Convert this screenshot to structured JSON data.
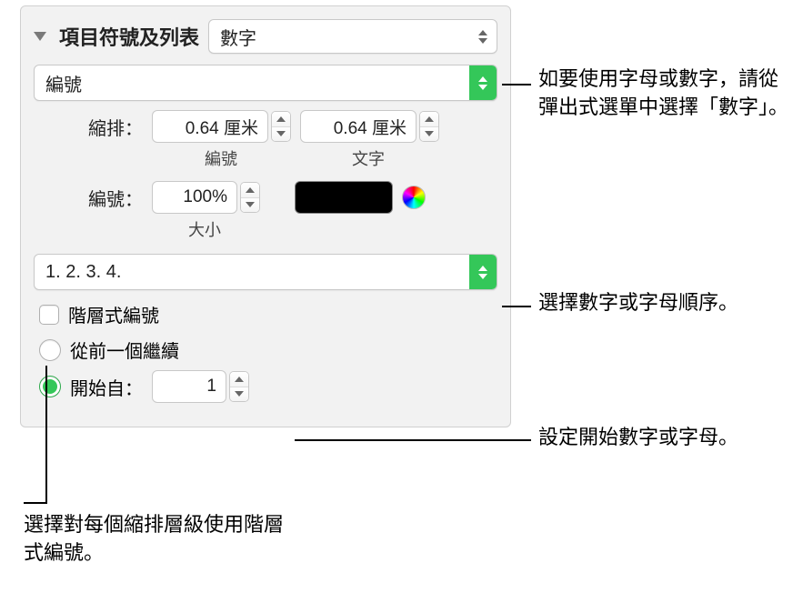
{
  "header": {
    "title": "項目符號及列表",
    "type_value": "數字"
  },
  "numbering": {
    "format_value": "編號",
    "indent_label": "縮排：",
    "indent_number_value": "0.64 厘米",
    "indent_text_value": "0.64 厘米",
    "sub_number": "編號",
    "sub_text": "文字",
    "size_label": "編號：",
    "size_value": "100%",
    "size_sub": "大小",
    "sequence_value": "1. 2. 3. 4.",
    "tiered_label": "階層式編號",
    "continue_label": "從前一個繼續",
    "start_from_label": "開始自：",
    "start_from_value": "1"
  },
  "callouts": {
    "c1": "如要使用字母或數字，請從彈出式選單中選擇「數字」。",
    "c2": "選擇數字或字母順序。",
    "c3": "設定開始數字或字母。",
    "c4": "選擇對每個縮排層級使用階層式編號。"
  }
}
